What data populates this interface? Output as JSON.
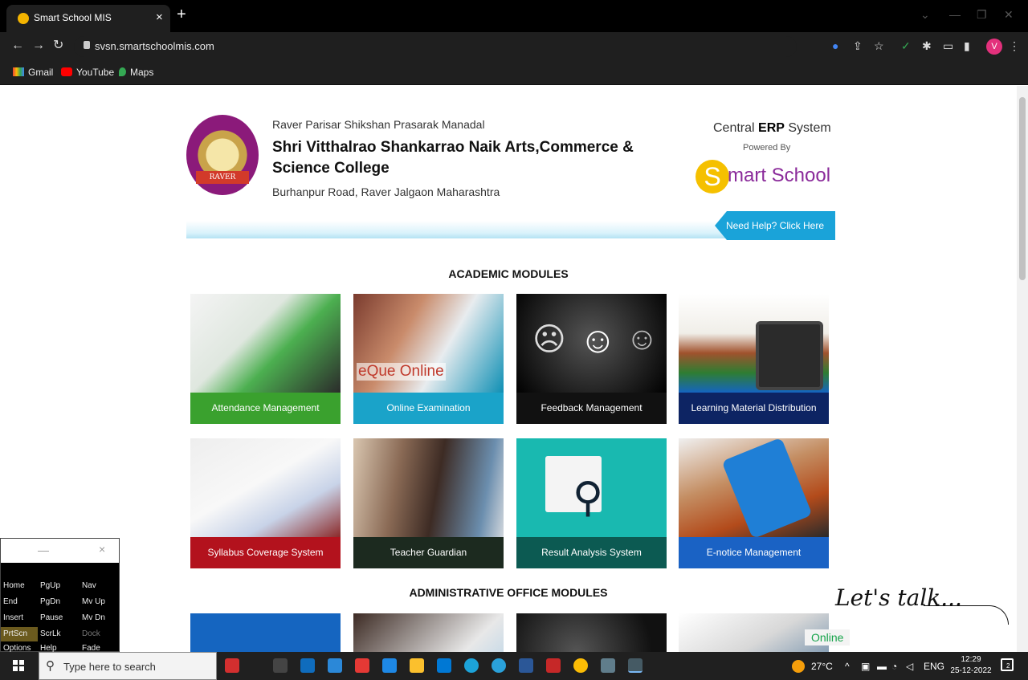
{
  "browser": {
    "tab_title": "Smart School MIS",
    "tab_close": "×",
    "new_tab": "+",
    "url": "svsn.smartschoolmis.com",
    "profile_initial": "V",
    "bookmarks": [
      "Gmail",
      "YouTube",
      "Maps"
    ]
  },
  "header": {
    "org": "Raver Parisar Shikshan Prasarak Manadal",
    "college": "Shri Vitthalrao Shankarrao Naik Arts,Commerce & Science College",
    "address": "Burhanpur Road, Raver Jalgaon Maharashtra",
    "logo_text": "RAVER",
    "erp_prefix": "Central ",
    "erp_bold": "ERP",
    "erp_suffix": " System",
    "powered_by": "Powered By",
    "brand_s": "S",
    "brand_rest": "mart School",
    "help": "Need Help? Click Here"
  },
  "sections": {
    "academic": "ACADEMIC MODULES",
    "admin": "ADMINISTRATIVE OFFICE MODULES"
  },
  "modules": [
    {
      "label": "Attendance Management",
      "color": "#3aa12e"
    },
    {
      "label": "Online Examination",
      "color": "#1aa3c9",
      "overlay": "eQue Online"
    },
    {
      "label": "Feedback Management",
      "color": "#111111"
    },
    {
      "label": "Learning Material Distribution",
      "color": "#0d2463"
    },
    {
      "label": "Syllabus Coverage System",
      "color": "#b3121d"
    },
    {
      "label": "Teacher Guardian",
      "color": "#1c2a1f"
    },
    {
      "label": "Result Analysis System",
      "color": "#0c5a52"
    },
    {
      "label": "E-notice Management",
      "color": "#1a62c4"
    }
  ],
  "osk": {
    "min": "—",
    "close": "×",
    "keys": [
      "Home",
      "PgUp",
      "Nav",
      "End",
      "PgDn",
      "Mv Up",
      "Insert",
      "Pause",
      "Mv Dn",
      "PrtScn",
      "ScrLk",
      "Dock",
      "Options",
      "Help",
      "Fade"
    ]
  },
  "chat": {
    "script": "Let's talk...",
    "online": "Online"
  },
  "taskbar": {
    "search": "Type here to search",
    "weather": "27°C",
    "lang": "ENG",
    "time": "12:29",
    "date": "25-12-2022",
    "notif_count": "2"
  }
}
